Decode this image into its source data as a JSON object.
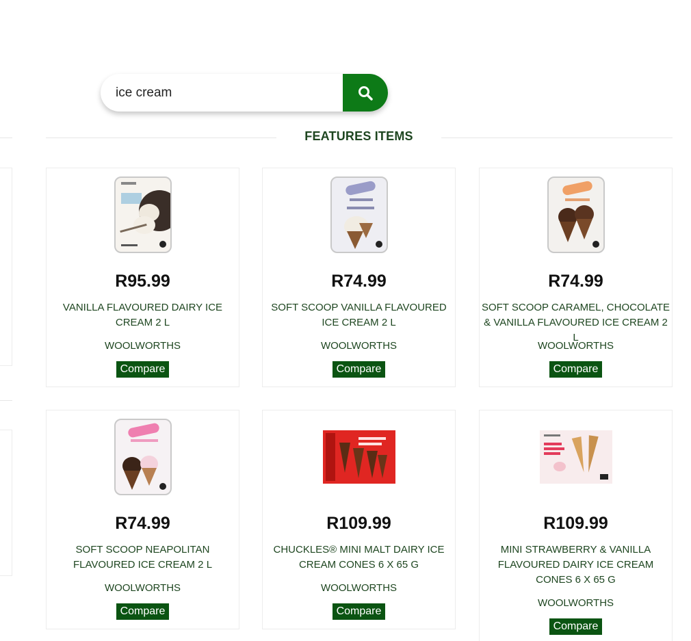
{
  "search": {
    "value": "ice cream",
    "placeholder": ""
  },
  "section": {
    "title": "FEATURES ITEMS"
  },
  "colors": {
    "brand_green": "#0d7a17",
    "button_green": "#0b5412",
    "text_green": "#1e4620"
  },
  "icons": {
    "search": "search-icon"
  },
  "products": [
    {
      "price": "R95.99",
      "name": "VANILLA FLAVOURED DAIRY ICE CREAM 2 L",
      "brand": "WOOLWORTHS",
      "compare_label": "Compare"
    },
    {
      "price": "R74.99",
      "name": "SOFT SCOOP VANILLA FLAVOURED ICE CREAM 2 L",
      "brand": "WOOLWORTHS",
      "compare_label": "Compare"
    },
    {
      "price": "R74.99",
      "name": "SOFT SCOOP CARAMEL, CHOCOLATE & VANILLA FLAVOURED ICE CREAM 2 L",
      "brand": "WOOLWORTHS",
      "compare_label": "Compare"
    },
    {
      "price": "R74.99",
      "name": "SOFT SCOOP NEAPOLITAN FLAVOURED ICE CREAM 2 L",
      "brand": "WOOLWORTHS",
      "compare_label": "Compare"
    },
    {
      "price": "R109.99",
      "name": "CHUCKLES® MINI MALT DAIRY ICE CREAM CONES 6 X 65 G",
      "brand": "WOOLWORTHS",
      "compare_label": "Compare"
    },
    {
      "price": "R109.99",
      "name": "MINI STRAWBERRY & VANILLA FLAVOURED DAIRY ICE CREAM CONES 6 X 65 G",
      "brand": "WOOLWORTHS",
      "compare_label": "Compare"
    }
  ]
}
